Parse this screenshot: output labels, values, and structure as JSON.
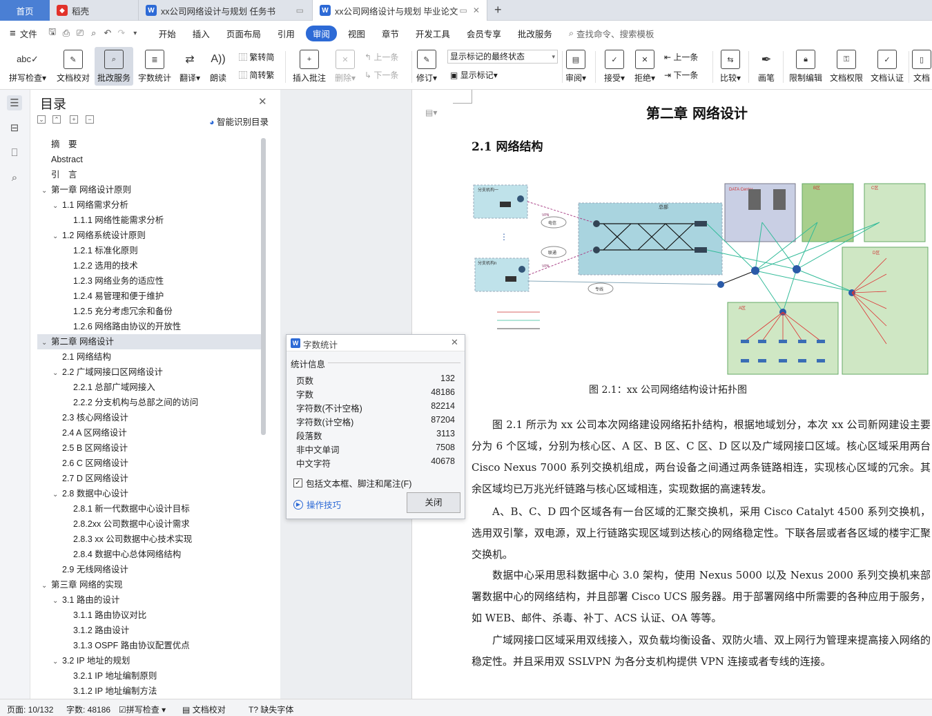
{
  "tabs": [
    {
      "label": "首页"
    },
    {
      "label": "稻壳"
    },
    {
      "label": "xx公司网络设计与规划 任务书"
    },
    {
      "label": "xx公司网络设计与规划 毕业论文"
    }
  ],
  "menu": {
    "file": "文件",
    "items": [
      "开始",
      "插入",
      "页面布局",
      "引用",
      "审阅",
      "视图",
      "章节",
      "开发工具",
      "会员专享",
      "批改服务"
    ],
    "active": "审阅",
    "search_placeholder": "查找命令、搜索模板"
  },
  "ribbon": {
    "spell": "拼写检查",
    "proof": "文档校对",
    "review_service": "批改服务",
    "word_count": "字数统计",
    "translate": "翻译",
    "read_aloud": "朗读",
    "trad": "繁转简",
    "simp": "简转繁",
    "insert_comment": "插入批注",
    "delete": "删除",
    "prev": "上一条",
    "next": "下一条",
    "revise": "修订",
    "markup_select": "显示标记的最终状态",
    "show_markup": "显示标记",
    "review": "审阅",
    "accept": "接受",
    "reject": "拒绝",
    "prev2": "上一条",
    "next2": "下一条",
    "compare": "比较",
    "pen": "画笔",
    "restrict": "限制编辑",
    "doc_rights": "文档权限",
    "doc_cert": "文档认证",
    "doc_more": "文档"
  },
  "toc": {
    "title": "目录",
    "smart": "智能识别目录",
    "items": [
      {
        "label": "摘　要",
        "level": 0
      },
      {
        "label": "Abstract",
        "level": 0
      },
      {
        "label": "引　言",
        "level": 0
      },
      {
        "label": "第一章 网络设计原则",
        "level": 1
      },
      {
        "label": "1.1 网络需求分析",
        "level": 2
      },
      {
        "label": "1.1.1 网络性能需求分析",
        "level": 3
      },
      {
        "label": "1.2 网络系统设计原则",
        "level": 2
      },
      {
        "label": "1.2.1 标准化原则",
        "level": 3
      },
      {
        "label": "1.2.2 选用的技术",
        "level": 3
      },
      {
        "label": "1.2.3 网络业务的适应性",
        "level": 3
      },
      {
        "label": "1.2.4 易管理和便于维护",
        "level": 3
      },
      {
        "label": "1.2.5 充分考虑冗余和备份",
        "level": 3
      },
      {
        "label": "1.2.6 网络路由协议的开放性",
        "level": 3
      },
      {
        "label": "第二章 网络设计",
        "level": 1
      },
      {
        "label": "2.1 网络结构",
        "level": 4
      },
      {
        "label": "2.2 广域网接口区网络设计",
        "level": 2
      },
      {
        "label": "2.2.1 总部广域网接入",
        "level": 3
      },
      {
        "label": "2.2.2 分支机构与总部之间的访问",
        "level": 3
      },
      {
        "label": "2.3 核心网络设计",
        "level": 4
      },
      {
        "label": "2.4 A 区网络设计",
        "level": 4
      },
      {
        "label": "2.5 B 区网络设计",
        "level": 4
      },
      {
        "label": "2.6 C 区网络设计",
        "level": 4
      },
      {
        "label": "2.7 D 区网络设计",
        "level": 4
      },
      {
        "label": "2.8 数据中心设计",
        "level": 2
      },
      {
        "label": "2.8.1 新一代数据中心设计目标",
        "level": 3
      },
      {
        "label": "2.8.2xx 公司数据中心设计需求",
        "level": 3
      },
      {
        "label": "2.8.3 xx 公司数据中心技术实现",
        "level": 3
      },
      {
        "label": "2.8.4 数据中心总体网络结构",
        "level": 3
      },
      {
        "label": "2.9 无线网络设计",
        "level": 4
      },
      {
        "label": "第三章 网络的实现",
        "level": 1
      },
      {
        "label": "3.1 路由的设计",
        "level": 2
      },
      {
        "label": "3.1.1 路由协议对比",
        "level": 3
      },
      {
        "label": "3.1.2 路由设计",
        "level": 3
      },
      {
        "label": "3.1.3 OSPF 路由协议配置优点",
        "level": 3
      },
      {
        "label": "3.2 IP 地址的规划",
        "level": 2
      },
      {
        "label": "3.2.1 IP 地址编制原则",
        "level": 3
      },
      {
        "label": "3.1.2 IP 地址编制方法",
        "level": 3
      }
    ]
  },
  "document": {
    "chapter": "第二章 网络设计",
    "section": "2.1 网络结构",
    "figure_caption": "图 2.1：xx 公司网络结构设计拓扑图",
    "figure_labels": {
      "branch1": "分支机构一",
      "branchn": "分支机构n",
      "hq": "总部",
      "telecom": "电信",
      "unicom": "联通",
      "private_line": "专线",
      "vpn": "VPN",
      "datacenter": "DATA Center",
      "zone_a": "A区",
      "zone_b": "B区",
      "zone_c": "C区",
      "zone_d": "D区"
    },
    "paragraphs": [
      "图 2.1 所示为 xx 公司本次网络建设网络拓扑结构，根据地域划分，本次 xx 公司新网建设主要分为 6 个区域，分别为核心区、A 区、B 区、C 区、D 区以及广域网接口区域。核心区域采用两台 Cisco Nexus 7000 系列交换机组成，两台设备之间通过两条链路相连，实现核心区域的冗余。其余区域均已万兆光纤链路与核心区域相连，实现数据的高速转发。",
      "A、B、C、D 四个区域各有一台区域的汇聚交换机，采用 Cisco Catalyt 4500 系列交换机，选用双引擎，双电源，双上行链路实现区域到达核心的网络稳定性。下联各层或者各区域的楼宇汇聚交换机。",
      "数据中心采用思科数据中心 3.0 架构，使用 Nexus 5000 以及 Nexus 2000 系列交换机来部署数据中心的网络结构，并且部署 Cisco UCS 服务器。用于部署网络中所需要的各种应用于服务，如 WEB、邮件、杀毒、补丁、ACS 认证、OA 等等。",
      "广域网接口区域采用双线接入，双负载均衡设备、双防火墙、双上网行为管理来提高接入网络的稳定性。并且采用双 SSLVPN 为各分支机构提供 VPN 连接或者专线的连接。"
    ]
  },
  "word_count_dialog": {
    "title": "字数统计",
    "section": "统计信息",
    "rows": [
      {
        "label": "页数",
        "value": "132"
      },
      {
        "label": "字数",
        "value": "48186"
      },
      {
        "label": "字符数(不计空格)",
        "value": "82214"
      },
      {
        "label": "字符数(计空格)",
        "value": "87204"
      },
      {
        "label": "段落数",
        "value": "3113"
      },
      {
        "label": "非中文单词",
        "value": "7508"
      },
      {
        "label": "中文字符",
        "value": "40678"
      }
    ],
    "checkbox": "包括文本框、脚注和尾注(F)",
    "checked": true,
    "tips": "操作技巧",
    "close": "关闭"
  },
  "status": {
    "page": "页面: 10/132",
    "words": "字数: 48186",
    "spell": "拼写检查",
    "proof": "文档校对",
    "missing_font": "缺失字体"
  },
  "colors": {
    "accent": "#2d6ad6",
    "home_tab": "#4a7fd4",
    "daoke": "#e2322a"
  }
}
